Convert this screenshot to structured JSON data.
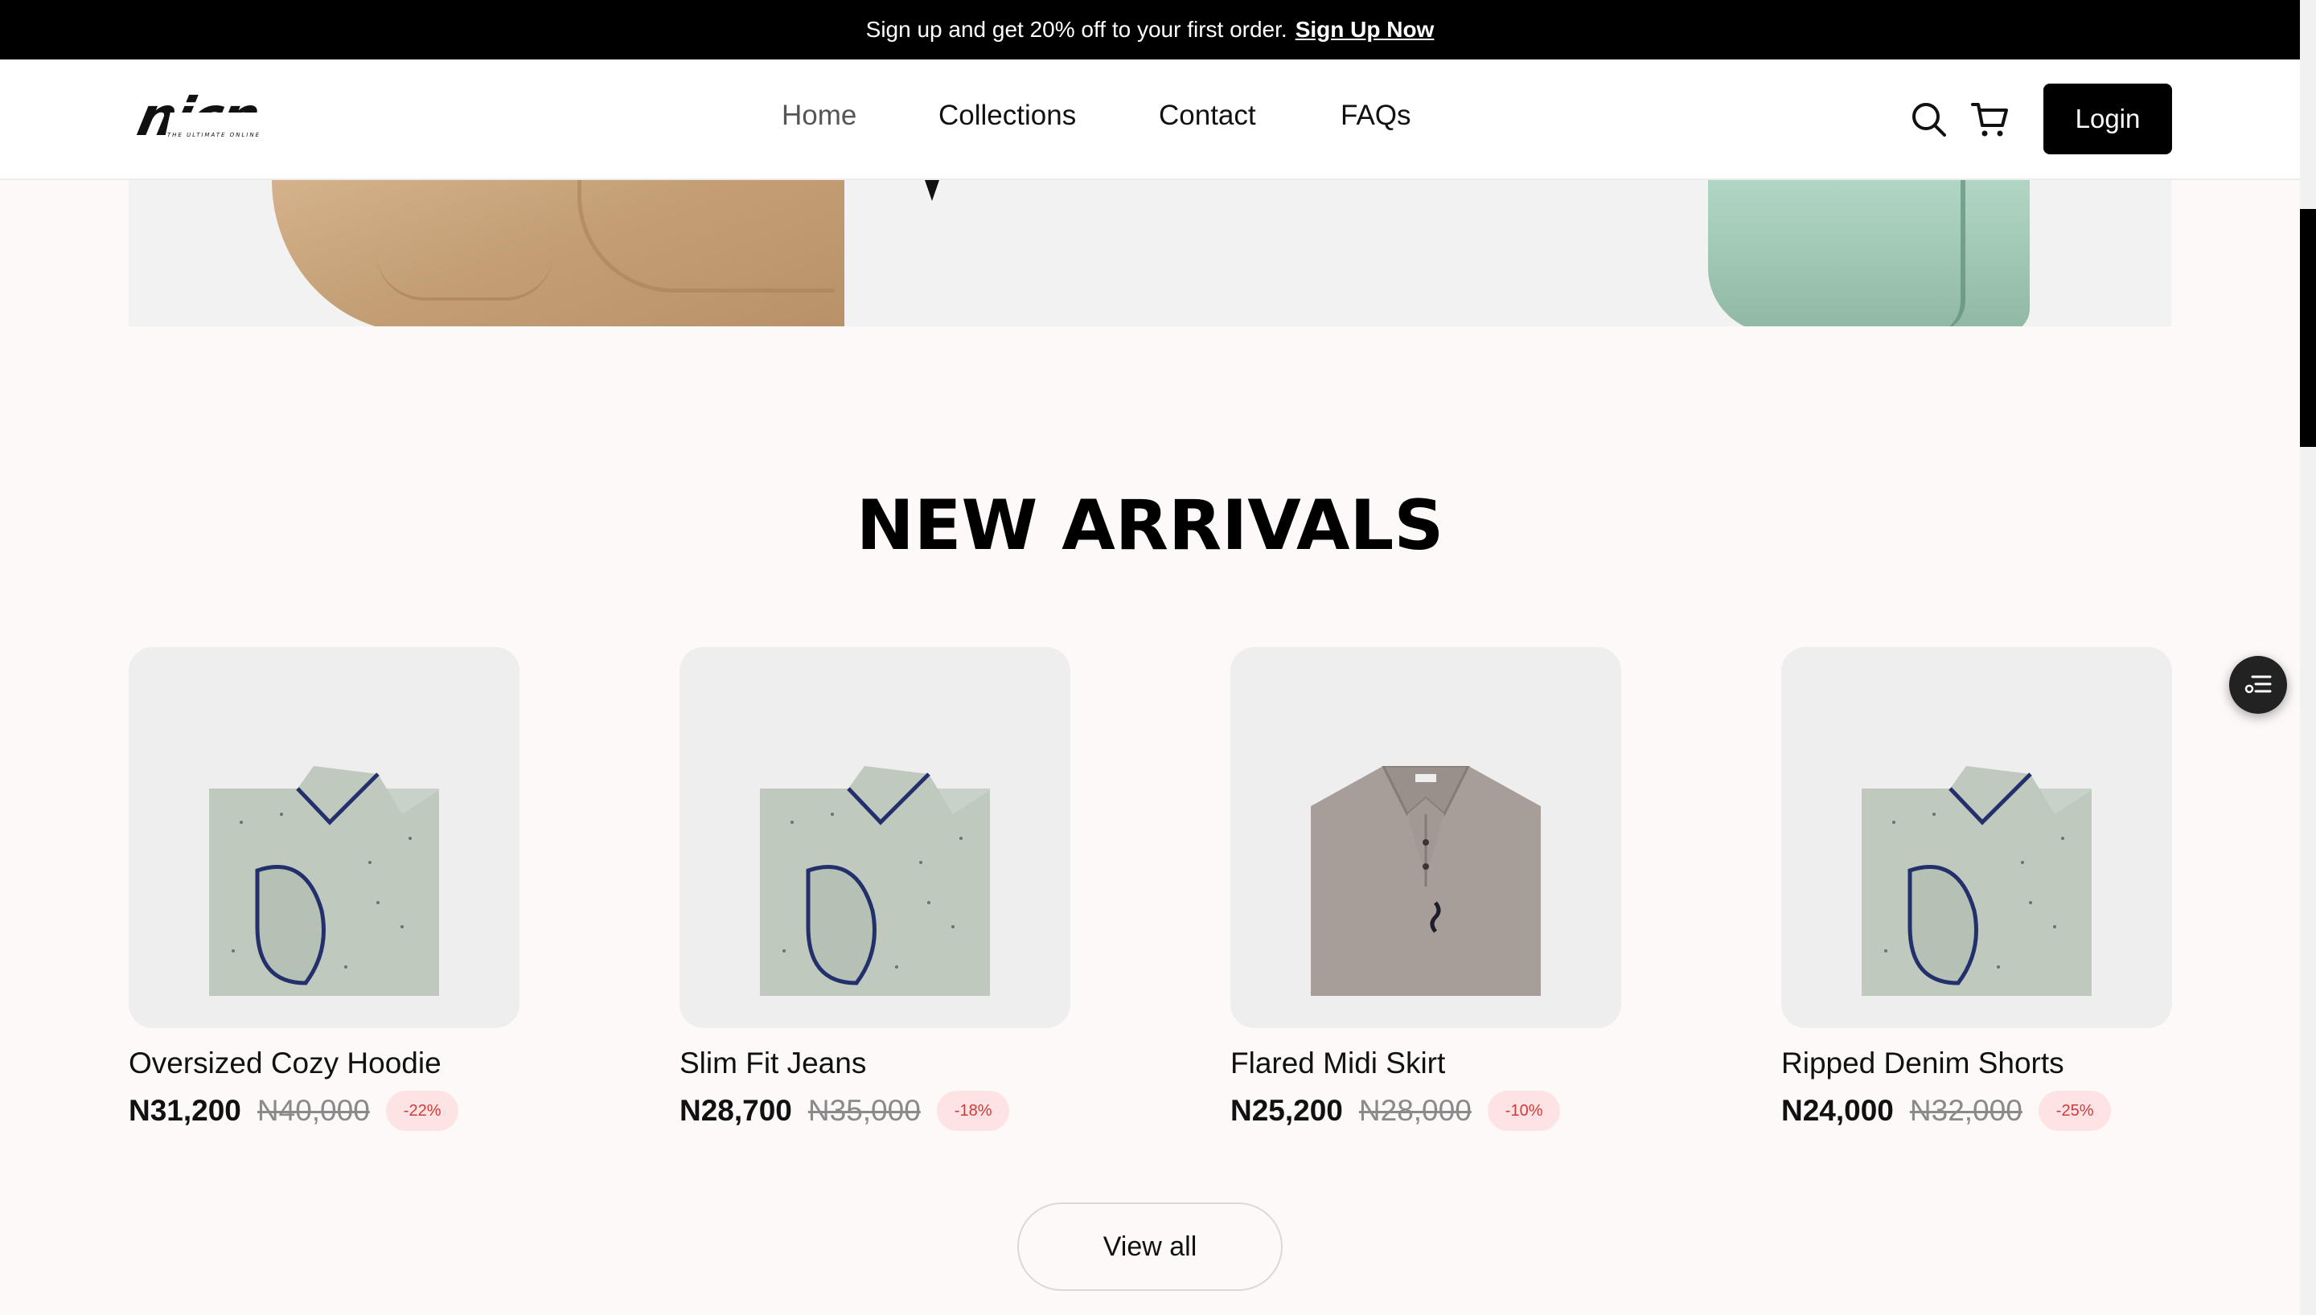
{
  "announcement": {
    "text": "Sign up and get 20% off to your first order.",
    "link": "Sign Up Now"
  },
  "header": {
    "logo": "nicn",
    "logo_tagline": "THE ULTIMATE ONLINE",
    "nav": [
      {
        "label": "Home",
        "active": true
      },
      {
        "label": "Collections",
        "active": false
      },
      {
        "label": "Contact",
        "active": false
      },
      {
        "label": "FAQs",
        "active": false
      }
    ],
    "icons": [
      "search-icon",
      "cart-icon"
    ],
    "login_label": "Login"
  },
  "new_arrivals": {
    "title": "NEW ARRIVALS",
    "products": [
      {
        "name": "Oversized Cozy Hoodie",
        "price": "N31,200",
        "old_price": "N40,000",
        "discount": "-22%",
        "image": "sage-polo-shirt"
      },
      {
        "name": "Slim Fit Jeans",
        "price": "N28,700",
        "old_price": "N35,000",
        "discount": "-18%",
        "image": "sage-polo-shirt"
      },
      {
        "name": "Flared Midi Skirt",
        "price": "N25,200",
        "old_price": "N28,000",
        "discount": "-10%",
        "image": "taupe-polo-shirt"
      },
      {
        "name": "Ripped Denim Shorts",
        "price": "N24,000",
        "old_price": "N32,000",
        "discount": "-25%",
        "image": "sage-polo-shirt"
      }
    ],
    "view_all_label": "View all"
  },
  "colors": {
    "announcement_bg": "#000000",
    "page_bg": "#fdf9f8",
    "badge_text": "#d2383a",
    "badge_bg": "#fde3e3"
  }
}
